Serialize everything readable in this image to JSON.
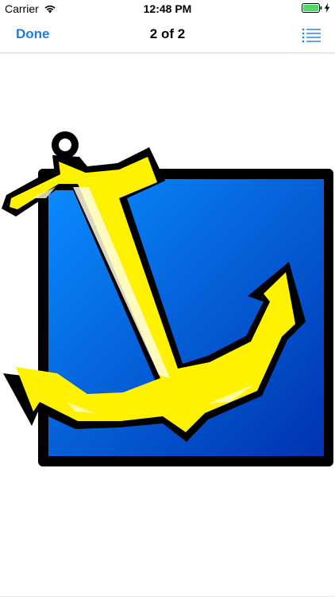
{
  "status_bar": {
    "carrier": "Carrier",
    "time": "12:48 PM",
    "wifi_icon": "wifi-icon",
    "battery_icon": "battery-icon",
    "charging_icon": "charging-bolt-icon",
    "battery_color": "#4cd964"
  },
  "nav_bar": {
    "done_label": "Done",
    "title": "2 of 2",
    "list_icon": "list-icon",
    "accent_color": "#1a7ee6"
  },
  "content": {
    "image_icon": "anchor-icon",
    "colors": {
      "background_blue": "#0066dd",
      "anchor_yellow": "#fff200",
      "outline": "#000000"
    }
  }
}
